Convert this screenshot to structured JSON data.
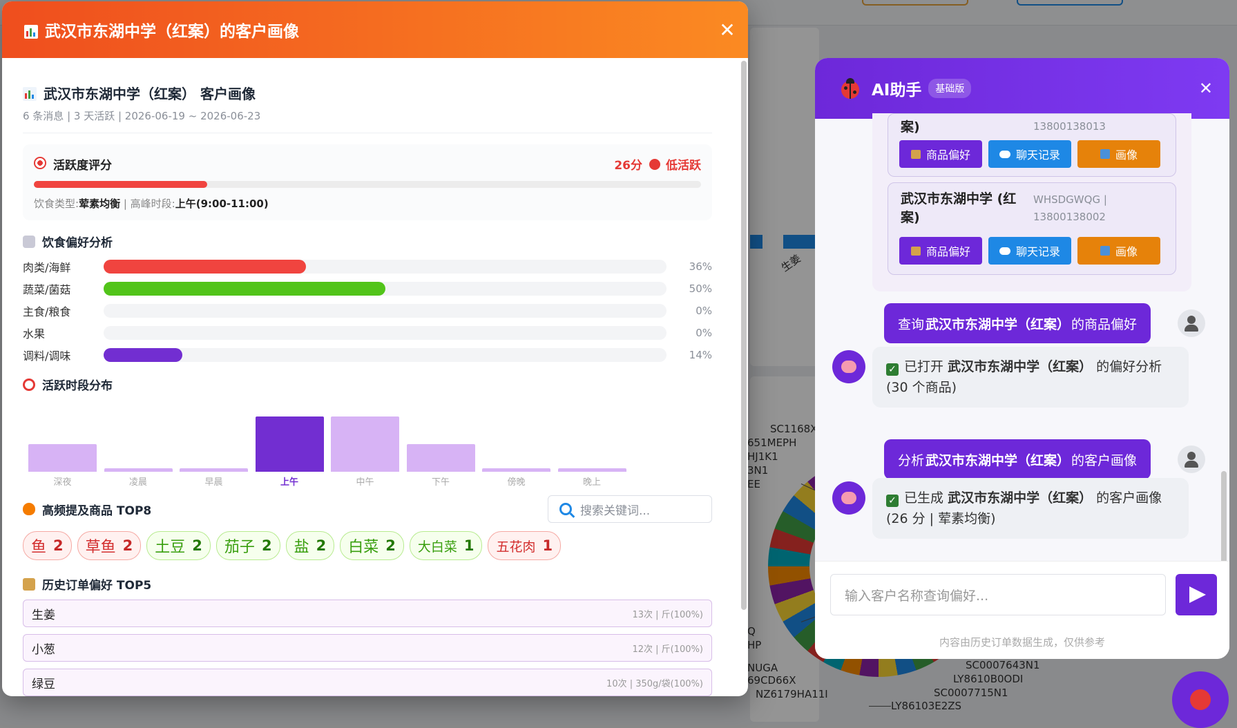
{
  "modal": {
    "title": "武汉市东湖中学（红案）的客户画像",
    "summary_title": "武汉市东湖中学（红案） 客户画像",
    "summary_sub": "6 条消息 | 3 天活跃 | 2026-06-19 ~ 2026-06-23",
    "activity": {
      "title": "活跃度评分",
      "score": "26分",
      "level": "低活跃",
      "fill": 0.26,
      "diet_label": "饮食类型:",
      "diet_value": "荤素均衡",
      "peak_label": "高峰时段:",
      "peak_value": "上午(9:00-11:00)"
    },
    "diet_pref": {
      "title": "饮食偏好分析",
      "rows": [
        {
          "label": "肉类/海鲜",
          "pct": "36%",
          "value": 36,
          "color": "#f0443f"
        },
        {
          "label": "蔬菜/菌菇",
          "pct": "50%",
          "value": 50,
          "color": "#52c41a"
        },
        {
          "label": "主食/粮食",
          "pct": "0%",
          "value": 0,
          "color": "#f0a020"
        },
        {
          "label": "水果",
          "pct": "0%",
          "value": 0,
          "color": "#fa8c16"
        },
        {
          "label": "调料/调味",
          "pct": "14%",
          "value": 14,
          "color": "#722ed1"
        }
      ]
    },
    "time_dist": {
      "title": "活跃时段分布",
      "slots": [
        {
          "label": "深夜",
          "value": 0.5,
          "active": false
        },
        {
          "label": "凌晨",
          "value": 0.06,
          "active": false
        },
        {
          "label": "早晨",
          "value": 0.06,
          "active": false
        },
        {
          "label": "上午",
          "value": 1.0,
          "active": true
        },
        {
          "label": "中午",
          "value": 1.0,
          "active": false
        },
        {
          "label": "下午",
          "value": 0.5,
          "active": false
        },
        {
          "label": "傍晚",
          "value": 0.06,
          "active": false
        },
        {
          "label": "晚上",
          "value": 0.06,
          "active": false
        }
      ]
    },
    "top_products": {
      "title": "高频提及商品 TOP8",
      "search_placeholder": "搜索关键词...",
      "tags": [
        {
          "name": "鱼",
          "count": "2",
          "tone": "red"
        },
        {
          "name": "草鱼",
          "count": "2",
          "tone": "red"
        },
        {
          "name": "土豆",
          "count": "2",
          "tone": "green"
        },
        {
          "name": "茄子",
          "count": "2",
          "tone": "green"
        },
        {
          "name": "盐",
          "count": "2",
          "tone": "green"
        },
        {
          "name": "白菜",
          "count": "2",
          "tone": "green"
        },
        {
          "name": "大白菜",
          "count": "1",
          "tone": "green"
        },
        {
          "name": "五花肉",
          "count": "1",
          "tone": "red"
        }
      ]
    },
    "order_pref": {
      "title": "历史订单偏好 TOP5",
      "items": [
        {
          "name": "生姜",
          "meta": "13次 | 斤(100%)"
        },
        {
          "name": "小葱",
          "meta": "12次 | 斤(100%)"
        },
        {
          "name": "绿豆",
          "meta": "10次 | 350g/袋(100%)"
        }
      ]
    }
  },
  "ai": {
    "title": "AI助手",
    "badge": "基础版",
    "customers": [
      {
        "name_line1": "案)",
        "name_line2": "",
        "code_line1": "13800138013",
        "code_line2": ""
      },
      {
        "name_line1": "武汉市东湖中学 (红",
        "name_line2": "案)",
        "code_line1": "WHSDGWQG |",
        "code_line2": "13800138002"
      }
    ],
    "btn_pref": "商品偏好",
    "btn_chat": "聊天记录",
    "btn_portrait": "画像",
    "messages": [
      {
        "pre": "查询",
        "name": "武汉市东湖中学（红案）",
        "post": "的商品偏好"
      },
      {
        "pre": "已打开",
        "name": "武汉市东湖中学（红案）",
        "post": "的偏好分析",
        "line2": "(30 个商品)"
      },
      {
        "pre": "分析",
        "name": "武汉市东湖中学（红案）",
        "post": "的客户画像"
      },
      {
        "pre": "已生成",
        "name": "武汉市东湖中学（红案）",
        "post": "的客户画像",
        "line2": "(26 分 | 荤素均衡)"
      }
    ],
    "input_placeholder": "输入客户名称查询偏好...",
    "footer": "内容由历史订单数据生成，仅供参考"
  },
  "background": {
    "bar_label": "生姜",
    "codes_left": [
      "SC1168X",
      "651MEPH",
      "HJ1K1",
      "3N1",
      "EE",
      "Q",
      "HP",
      "NUGA",
      "69CD66X",
      "NZ6179HA11I"
    ],
    "codes_bottom": [
      "SC0007643N1",
      "LY8610B0ODI",
      "SC0007715N1",
      "LY86103E2ZS"
    ]
  },
  "colors": {
    "brand_orange": "#ef4e1e",
    "brand_purple": "#6d28d9",
    "danger": "#e53935"
  }
}
